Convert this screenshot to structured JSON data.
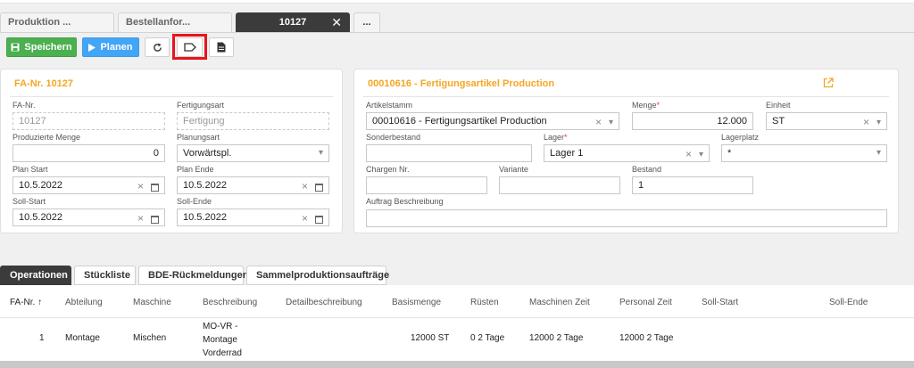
{
  "tabs": [
    {
      "label": "Produktion ..."
    },
    {
      "label": "Bestellanfor..."
    },
    {
      "label": "10127"
    },
    {
      "label": "..."
    }
  ],
  "toolbar": {
    "save_label": "Speichern",
    "plan_label": "Planen"
  },
  "left_card": {
    "title": "FA-Nr. 10127",
    "fa_nr": {
      "label": "FA-Nr.",
      "value": "10127"
    },
    "fertigungsart": {
      "label": "Fertigungsart",
      "value": "Fertigung"
    },
    "menge": {
      "label": "Produzierte Menge",
      "value": "0"
    },
    "planungsart": {
      "label": "Planungsart",
      "value": "Vorwärtspl."
    },
    "plan_start": {
      "label": "Plan Start",
      "value": "10.5.2022"
    },
    "plan_ende": {
      "label": "Plan Ende",
      "value": "10.5.2022"
    },
    "soll_start": {
      "label": "Soll-Start",
      "value": "10.5.2022"
    },
    "soll_ende": {
      "label": "Soll-Ende",
      "value": "10.5.2022"
    }
  },
  "right_card": {
    "title": "00010616 - Fertigungsartikel Production",
    "artikelstamm": {
      "label": "Artikelstamm",
      "value": "00010616 - Fertigungsartikel Production"
    },
    "menge": {
      "label": "Menge",
      "value": "12.000"
    },
    "einheit": {
      "label": "Einheit",
      "value": "ST"
    },
    "sonderbestand": {
      "label": "Sonderbestand",
      "value": ""
    },
    "lager": {
      "label": "Lager",
      "value": "Lager 1"
    },
    "lagerplatz": {
      "label": "Lagerplatz",
      "value": "*"
    },
    "chargen": {
      "label": "Chargen Nr.",
      "value": ""
    },
    "variante": {
      "label": "Variante",
      "value": ""
    },
    "bestand": {
      "label": "Bestand",
      "value": "1"
    },
    "beschreibung": {
      "label": "Auftrag Beschreibung",
      "value": ""
    }
  },
  "lower_tabs": [
    {
      "label": "Operationen"
    },
    {
      "label": "Stückliste"
    },
    {
      "label": "BDE-Rückmeldungen"
    },
    {
      "label": "Sammelproduktionsaufträge"
    }
  ],
  "grid": {
    "columns": [
      "FA-Nr.",
      "Abteilung",
      "Maschine",
      "Beschreibung",
      "Detailbeschreibung",
      "Basismenge",
      "Rüsten",
      "Maschinen Zeit",
      "Personal Zeit",
      "Soll-Start",
      "Soll-Ende"
    ],
    "rows": [
      {
        "fa_nr": "1",
        "abteilung": "Montage",
        "maschine": "Mischen",
        "beschreibung": "MO-VR - Montage Vorderrad",
        "detail": "",
        "basismenge": "12000 ST",
        "ruesten": "0 2 Tage",
        "maschinen_zeit": "12000 2 Tage",
        "personal_zeit": "12000 2 Tage",
        "soll_start": "",
        "soll_ende": ""
      }
    ]
  }
}
